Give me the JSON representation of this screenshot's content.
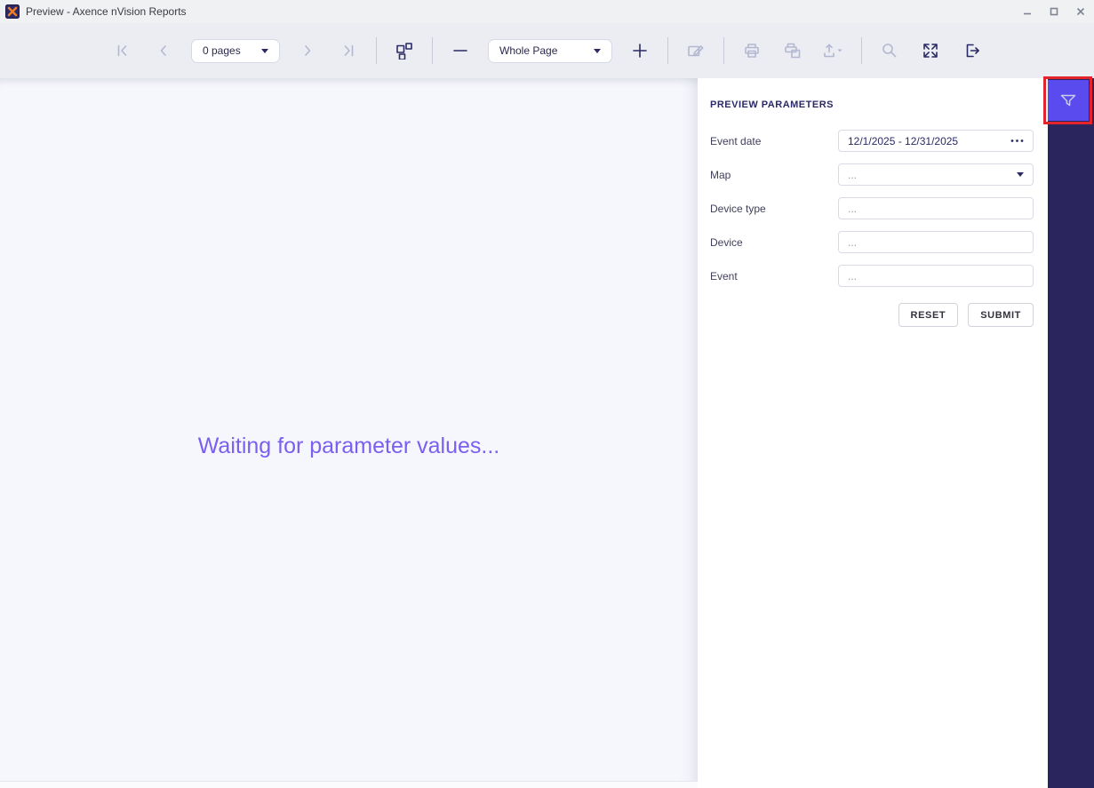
{
  "window": {
    "title": "Preview - Axence nVision Reports",
    "app_icon": "axence-logo-icon",
    "controls": [
      "minimize",
      "maximize",
      "close"
    ]
  },
  "toolbar": {
    "pages_select_value": "0 pages",
    "zoom_select_value": "Whole Page",
    "icons": [
      {
        "name": "first-page-icon",
        "enabled": false
      },
      {
        "name": "previous-page-icon",
        "enabled": false
      },
      {
        "name": "next-page-icon",
        "enabled": false
      },
      {
        "name": "last-page-icon",
        "enabled": false
      },
      {
        "name": "multipage-view-icon",
        "enabled": true
      },
      {
        "name": "zoom-out-icon",
        "enabled": true
      },
      {
        "name": "zoom-in-icon",
        "enabled": true
      },
      {
        "name": "edit-icon",
        "enabled": false
      },
      {
        "name": "print-icon",
        "enabled": false
      },
      {
        "name": "quick-print-icon",
        "enabled": false
      },
      {
        "name": "export-icon",
        "enabled": false
      },
      {
        "name": "search-icon",
        "enabled": false
      },
      {
        "name": "full-screen-icon",
        "enabled": true
      },
      {
        "name": "exit-icon",
        "enabled": true
      }
    ]
  },
  "preview": {
    "message": "Waiting for parameter values..."
  },
  "parameters_panel": {
    "title": "PREVIEW PARAMETERS",
    "fields": [
      {
        "label": "Event date",
        "value": "12/1/2025 - 12/31/2025",
        "control": "date-range-with-ellipsis"
      },
      {
        "label": "Map",
        "value": "...",
        "control": "dropdown"
      },
      {
        "label": "Device type",
        "value": "...",
        "control": "text"
      },
      {
        "label": "Device",
        "value": "...",
        "control": "text"
      },
      {
        "label": "Event",
        "value": "...",
        "control": "text"
      }
    ],
    "reset_label": "RESET",
    "submit_label": "SUBMIT"
  },
  "side_rail": {
    "filter_icon": "filter-funnel-icon",
    "rail_color": "#2b255e",
    "button_color": "#5a4bef",
    "annotation_color": "#e3252b"
  },
  "colors": {
    "accent_purple": "#5a4bef",
    "navy_icon": "#2b2a66",
    "disabled_icon": "#b3b8d0",
    "waiting_text": "#7a5ff0",
    "annotation_red": "#e3252b"
  }
}
